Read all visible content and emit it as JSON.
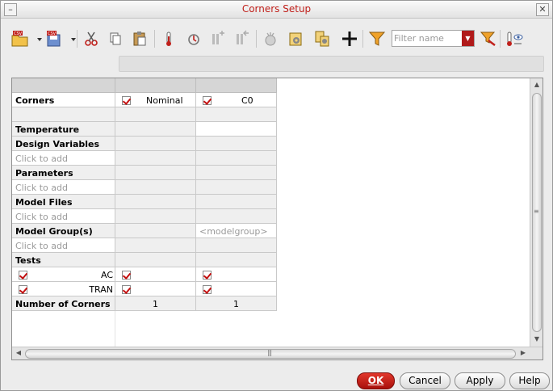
{
  "window": {
    "title": "Corners Setup",
    "minimize_glyph": "–",
    "close_glyph": "✕"
  },
  "toolbar": {
    "icons": [
      "open-csv-icon",
      "save-csv-icon",
      "cut-icon",
      "copy-icon",
      "paste-icon",
      "add-temperature-icon",
      "add-variable-icon",
      "add-parameter-icon",
      "add-model-file-icon",
      "clear-icon",
      "settings-icon",
      "import-icon",
      "move-icon",
      "filter-icon",
      "filter-name-input",
      "clear-filter-icon",
      "show-hide-icon"
    ],
    "filter_placeholder": "Filter name",
    "filter_value": ""
  },
  "table": {
    "columns": [
      {
        "label": "Nominal",
        "checked": true
      },
      {
        "label": "C0",
        "checked": true
      }
    ],
    "rows": {
      "corners": "Corners",
      "temperature": "Temperature",
      "design_variables": "Design Variables",
      "dv_add": "Click to add",
      "parameters": "Parameters",
      "param_add": "Click to add",
      "model_files": "Model Files",
      "mf_add": "Click to add",
      "model_groups": "Model Group(s)",
      "mg_placeholder": "<modelgroup>",
      "mg_add": "Click to add",
      "tests": "Tests",
      "test_ac": "AC",
      "test_tran": "TRAN",
      "number_of_corners": "Number of Corners",
      "num_nominal": "1",
      "num_c0": "1"
    }
  },
  "buttons": {
    "ok": "OK",
    "cancel": "Cancel",
    "apply": "Apply",
    "help": "Help"
  },
  "colors": {
    "accent": "#c0201b",
    "ok_button": "#c41e16",
    "check": "#c41010"
  }
}
